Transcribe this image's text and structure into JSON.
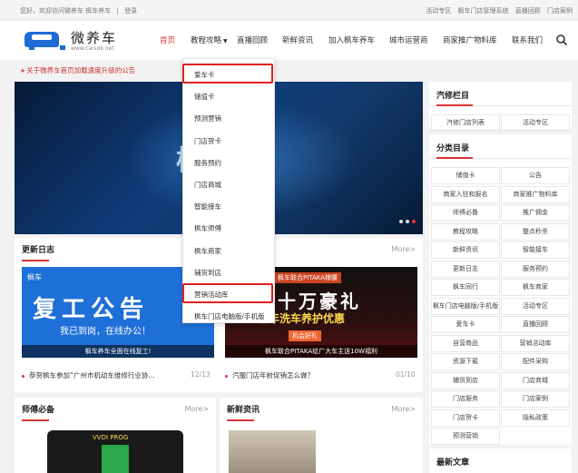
{
  "topbar": {
    "welcome": "您好，欢迎访问微养车 枫车养车",
    "sep": "|",
    "login": "登录",
    "links": [
      "活动专区",
      "枫车门店管理系统",
      "直播回顾",
      "门店案例"
    ]
  },
  "logo": {
    "name": "微养车",
    "url": "www.carsok.net"
  },
  "nav": {
    "items": [
      "首页",
      "教程攻略",
      "直播回顾",
      "新鲜资讯",
      "加入枫车养车",
      "城市运营商",
      "商家推广物料库",
      "联系我们"
    ]
  },
  "notice": "关于微养车首页加载速度升级的公告",
  "hero": {
    "word": "枫车"
  },
  "dropdown": {
    "items": [
      "爱车卡",
      "储值卡",
      "预测营销",
      "门店贺卡",
      "服务预约",
      "门店商城",
      "智能接车",
      "枫车师傅",
      "枫车商家",
      "辅货到店",
      "营销活动库",
      "枫车门店电脑版/手机版"
    ],
    "highlighted": [
      "爱车卡",
      "营销活动库"
    ]
  },
  "changelog": {
    "title": "更新日志",
    "more": "More>",
    "card1": {
      "brand": "枫车",
      "big": "复工公告",
      "sub": "我已到岗，在线办公！",
      "caption": "枫车养车全面在线复工!"
    },
    "card2": {
      "tag": "枫车联合PITAKA撑腰",
      "big1": "十万豪礼",
      "big2": "全年洗车养护优惠",
      "badge": "机会好礼",
      "caption": "枫车联合PITAKA给广大车主送10W福利"
    },
    "news": [
      {
        "text": "恭贺枫车参加“广州市机动车维修行业协...",
        "date": "12/13"
      },
      {
        "text": "汽服门店年前促销怎么做？",
        "date": "01/10"
      }
    ]
  },
  "bottom": {
    "left": {
      "title": "师傅必备",
      "more": "More>",
      "product": "VVDI PROG"
    },
    "right": {
      "title": "新鲜资讯",
      "more": "More>"
    }
  },
  "side": {
    "zone": {
      "title": "汽修栏目",
      "items": [
        "汽修门店列表",
        "活动专区"
      ]
    },
    "cat": {
      "title": "分类目录",
      "items": [
        "储值卡",
        "公告",
        "商家入驻和报名",
        "商家推广物料库",
        "师傅必备",
        "推广佣金",
        "教程攻略",
        "整点秒杀",
        "新鲜资讯",
        "智能接车",
        "更新日志",
        "服务预约",
        "枫车同行",
        "枫车商家",
        "枫车门店电脑版/手机版",
        "活动专区",
        "爱车卡",
        "直播回顾",
        "自营商品",
        "营销活动库",
        "资源下载",
        "配件采购",
        "辅货到店",
        "门店商城",
        "门店服务",
        "门店案例",
        "门店贺卡",
        "隐私政策",
        "预测营销"
      ]
    },
    "recent": {
      "title": "最新文章"
    }
  },
  "colors": {
    "accent": "#d33333",
    "menuHighlight": "#e02020",
    "heroDark": "#071a38"
  }
}
